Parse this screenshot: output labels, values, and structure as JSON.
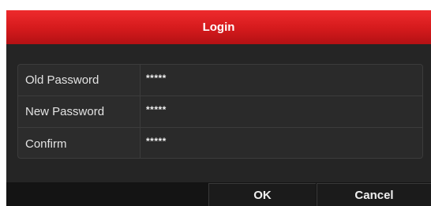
{
  "dialog": {
    "title": "Login"
  },
  "form": {
    "rows": [
      {
        "label": "Old Password",
        "value": "*****"
      },
      {
        "label": "New Password",
        "value": "*****"
      },
      {
        "label": "Confirm",
        "value": "*****"
      }
    ]
  },
  "buttons": {
    "ok_label": "OK",
    "cancel_label": "Cancel"
  },
  "colors": {
    "title_bar": "#d41a1c",
    "dialog_bg": "#252525"
  }
}
